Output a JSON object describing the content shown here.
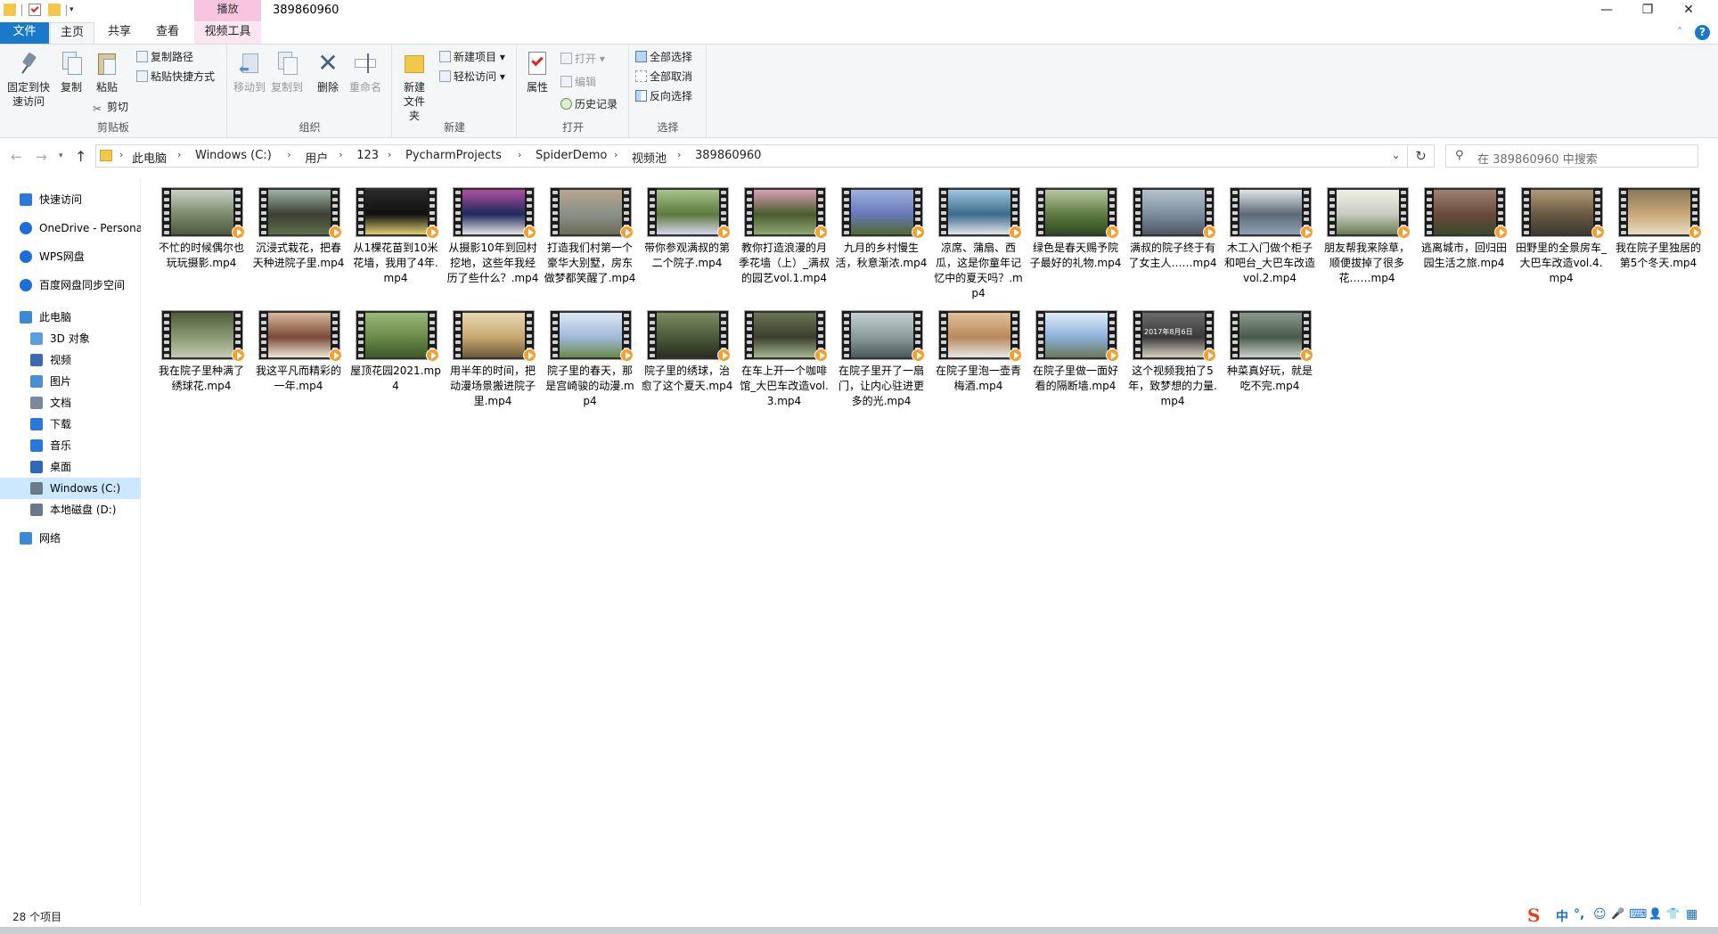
{
  "title_bar": {
    "title": "389860960",
    "context_tab_group": "播放",
    "controls": [
      "—",
      "❐",
      "✕"
    ]
  },
  "ribbon_tabs": {
    "file": "文件",
    "home": "主页",
    "share": "共享",
    "view": "查看",
    "video_tools": "视频工具",
    "collapse": "˄",
    "help": "?"
  },
  "ribbon": {
    "clipboard": {
      "label": "剪贴板",
      "pin": "固定到快速访问",
      "copy": "复制",
      "paste": "粘贴",
      "copy_path": "复制路径",
      "paste_shortcut": "粘贴快捷方式",
      "cut": "剪切"
    },
    "organize": {
      "label": "组织",
      "move_to": "移动到",
      "copy_to": "复制到",
      "delete": "删除",
      "rename": "重命名"
    },
    "new": {
      "label": "新建",
      "new_folder": "新建文件夹",
      "new_item": "新建项目",
      "easy_access": "轻松访问"
    },
    "open": {
      "label": "打开",
      "properties": "属性",
      "open": "打开",
      "edit": "编辑",
      "history": "历史记录"
    },
    "select": {
      "label": "选择",
      "select_all": "全部选择",
      "select_none": "全部取消",
      "invert": "反向选择"
    }
  },
  "address_bar": {
    "breadcrumbs": [
      "此电脑",
      "Windows (C:)",
      "用户",
      "123",
      "PycharmProjects",
      "SpiderDemo",
      "视频池",
      "389860960"
    ],
    "search_placeholder": "在 389860960 中搜索"
  },
  "nav_pane": {
    "items": [
      {
        "label": "快速访问",
        "icon": "star-icon"
      },
      {
        "label": "OneDrive - Personal",
        "icon": "cloud-icon"
      },
      {
        "label": "WPS网盘",
        "icon": "cloud-icon"
      },
      {
        "label": "百度网盘同步空间",
        "icon": "cloud-icon"
      },
      {
        "label": "此电脑",
        "icon": "computer-icon"
      },
      {
        "label": "3D 对象",
        "icon": "cube-icon"
      },
      {
        "label": "视频",
        "icon": "video-icon"
      },
      {
        "label": "图片",
        "icon": "picture-icon"
      },
      {
        "label": "文档",
        "icon": "document-icon"
      },
      {
        "label": "下载",
        "icon": "download-icon"
      },
      {
        "label": "音乐",
        "icon": "music-icon"
      },
      {
        "label": "桌面",
        "icon": "desktop-icon"
      },
      {
        "label": "Windows (C:)",
        "icon": "drive-icon"
      },
      {
        "label": "本地磁盘 (D:)",
        "icon": "drive-icon"
      },
      {
        "label": "网络",
        "icon": "network-icon"
      }
    ],
    "selected": "Windows (C:)"
  },
  "files": [
    {
      "name": "不忙的时候偶尔也玩玩摄影.mp4",
      "palette": [
        "#7b8a6a",
        "#c9d2c4",
        "#4e5a3e"
      ]
    },
    {
      "name": "沉浸式栽花，把春天种进院子里.mp4",
      "palette": [
        "#3c3f35",
        "#9fb2a5",
        "#5d6f4a"
      ]
    },
    {
      "name": "从1棵花苗到10米花墙，我用了4年.mp4",
      "palette": [
        "#101010",
        "#2a2a2a",
        "#e0d070"
      ]
    },
    {
      "name": "从摄影10年到回村挖地，这些年我经历了些什么？.mp4",
      "palette": [
        "#1e2a5a",
        "#b04fa0",
        "#e6e6e6"
      ]
    },
    {
      "name": "打造我们村第一个豪华大别墅，房东做梦都笑醒了.mp4",
      "palette": [
        "#8a8f88",
        "#b5a68e",
        "#6a6e58"
      ]
    },
    {
      "name": "带你参观满叔的第二个院子.mp4",
      "palette": [
        "#5c7a3c",
        "#a9c38c",
        "#d9d4ee"
      ]
    },
    {
      "name": "教你打造浪漫的月季花墙（上）_满叔的园艺vol.1.mp4",
      "palette": [
        "#4a5c2e",
        "#d9a0b5",
        "#8fa874"
      ]
    },
    {
      "name": "九月的乡村慢生活，秋意渐浓.mp4",
      "palette": [
        "#6878b8",
        "#9db2e0",
        "#4f6a34"
      ]
    },
    {
      "name": "凉席、蒲扇、西瓜，这是你童年记忆中的夏天吗？.mp4",
      "palette": [
        "#3a6a8a",
        "#9fc7e0",
        "#e2e6ea"
      ]
    },
    {
      "name": "绿色是春天赐予院子最好的礼物.mp4",
      "palette": [
        "#5f7a42",
        "#b5c7a0",
        "#2f4a22"
      ]
    },
    {
      "name": "满叔的院子终于有了女主人……mp4",
      "palette": [
        "#7c8c9c",
        "#b6c2cc",
        "#4e5864"
      ]
    },
    {
      "name": "木工入门做个柜子和吧台_大巴车改造vol.2.mp4",
      "palette": [
        "#5e6a78",
        "#dfe3e7",
        "#8da2b4"
      ]
    },
    {
      "name": "朋友帮我来除草，顺便拔掉了很多花……mp4",
      "palette": [
        "#c8cbc0",
        "#f0eee6",
        "#6b7a54"
      ]
    },
    {
      "name": "逃离城市，回归田园生活之旅.mp4",
      "palette": [
        "#6a4a3a",
        "#a08070",
        "#3a4a2a"
      ]
    },
    {
      "name": "田野里的全景房车_大巴车改造vol.4.mp4",
      "palette": [
        "#6a5a44",
        "#b09a78",
        "#3a3a2e"
      ]
    },
    {
      "name": "我在院子里独居的第5个冬天.mp4",
      "palette": [
        "#c8a878",
        "#8a7858",
        "#e8dcc4"
      ]
    },
    {
      "name": "我在院子里种满了绣球花.mp4",
      "palette": [
        "#8a9a74",
        "#4e5e3a",
        "#c4cab4"
      ]
    },
    {
      "name": "我这平凡而精彩的一年.mp4",
      "palette": [
        "#7a4a3a",
        "#d8b898",
        "#f0e8d8"
      ]
    },
    {
      "name": "屋顶花园2021.mp4",
      "palette": [
        "#6a8a4a",
        "#9ab878",
        "#3e5a2a"
      ]
    },
    {
      "name": "用半年的时间，把动漫场景搬进院子里.mp4",
      "palette": [
        "#c8a870",
        "#e8d8b0",
        "#6a5a3a"
      ]
    },
    {
      "name": "院子里的春天，那是宫崎骏的动漫.mp4",
      "palette": [
        "#a0b8d8",
        "#dce8f4",
        "#6a8a4a"
      ]
    },
    {
      "name": "院子里的绣球，治愈了这个夏天.mp4",
      "palette": [
        "#4a5a3a",
        "#7a8c62",
        "#2a2e22"
      ]
    },
    {
      "name": "在车上开一个咖啡馆_大巴车改造vol.3.mp4",
      "palette": [
        "#3a3e2e",
        "#6a7454",
        "#a8b490"
      ]
    },
    {
      "name": "在院子里开了一扇门，让内心驻进更多的光.mp4",
      "palette": [
        "#8a9a9a",
        "#c4d0d0",
        "#4a5a5a"
      ]
    },
    {
      "name": "在院子里泡一壶青梅酒.mp4",
      "palette": [
        "#b88a5a",
        "#e0c098",
        "#e6e6e6"
      ]
    },
    {
      "name": "在院子里做一面好看的隔断墙.mp4",
      "palette": [
        "#8ab0d8",
        "#e0ecf6",
        "#6a7a5a"
      ]
    },
    {
      "name": "这个视频我拍了5年，致梦想的力量.mp4",
      "palette": [
        "#3a3a3a",
        "#6a6a6a",
        "#d8d0c0"
      ],
      "overlay_text": "2017年8月6日"
    },
    {
      "name": "种菜真好玩，就是吃不完.mp4",
      "palette": [
        "#4a5a4a",
        "#8a9a8a",
        "#c8d0c8"
      ]
    }
  ],
  "status_bar": {
    "count": "28 个项目"
  },
  "ime": {
    "logo": "S",
    "lang": "中",
    "punct": "°,",
    "icons": [
      "☺",
      "🎤",
      "⌨",
      "👤",
      "👕",
      "▦"
    ]
  }
}
